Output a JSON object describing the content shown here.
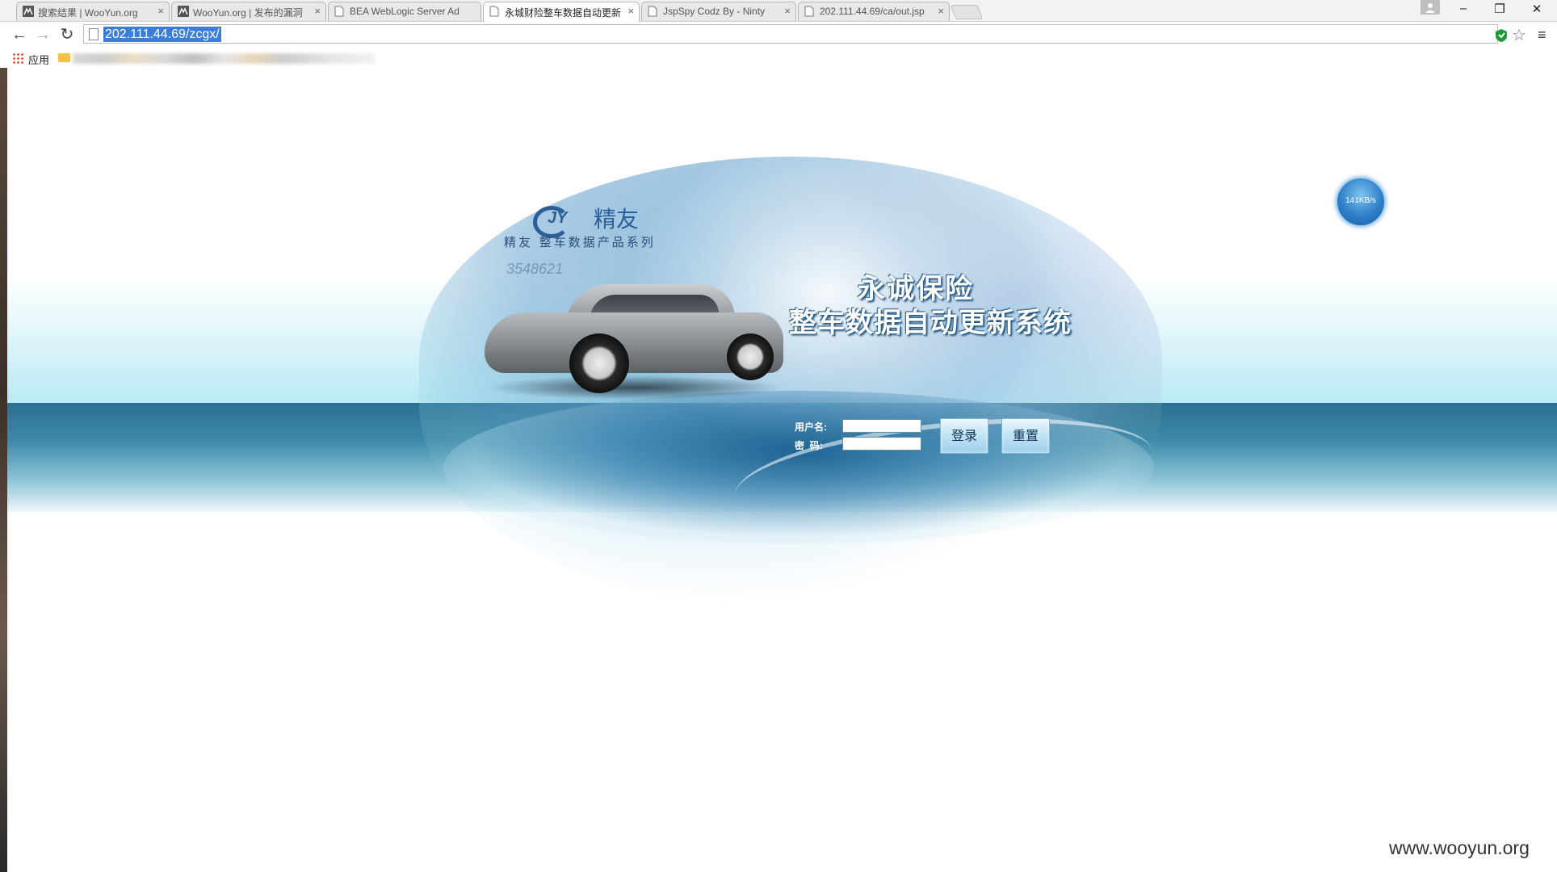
{
  "browser": {
    "tabs": [
      {
        "title": "搜索结果 | WooYun.org",
        "favicon": "wooyun-icon",
        "active": false
      },
      {
        "title": "WooYun.org | 发布的漏洞",
        "favicon": "wooyun-icon",
        "active": false
      },
      {
        "title": "BEA WebLogic Server Ad",
        "favicon": "page-icon",
        "active": false
      },
      {
        "title": "永城财险整车数据自动更新",
        "favicon": "page-icon",
        "active": true
      },
      {
        "title": "JspSpy Codz By - Ninty",
        "favicon": "page-icon",
        "active": false
      },
      {
        "title": "202.111.44.69/ca/out.jsp",
        "favicon": "page-icon",
        "active": false
      }
    ],
    "close_glyph": "×",
    "window_controls": {
      "minimize": "–",
      "restore": "❐",
      "close": "✕"
    },
    "nav": {
      "back": "←",
      "forward": "→",
      "reload": "↻"
    },
    "url": "202.111.44.69/zcgx/",
    "star": "☆",
    "menu": "≡",
    "bookmarks": {
      "apps_label": "应用"
    }
  },
  "page": {
    "brand": {
      "logo_text": "JY",
      "name": "精友",
      "subtitle": "精友 整车数据产品系列",
      "bg_number": "3548621"
    },
    "title_line1": "永诚保险",
    "title_line2": "整车数据自动更新系统",
    "login": {
      "username_label": "用户名:",
      "password_label": "密  码:",
      "username_value": "",
      "password_value": "",
      "login_button": "登录",
      "reset_button": "重置"
    },
    "speed_widget": "141KB/s"
  },
  "watermark": "www.wooyun.org",
  "colors": {
    "accent_blue": "#2a6f8f",
    "url_highlight": "#3b7dd8",
    "title_shadow": "#1a4f7a"
  }
}
